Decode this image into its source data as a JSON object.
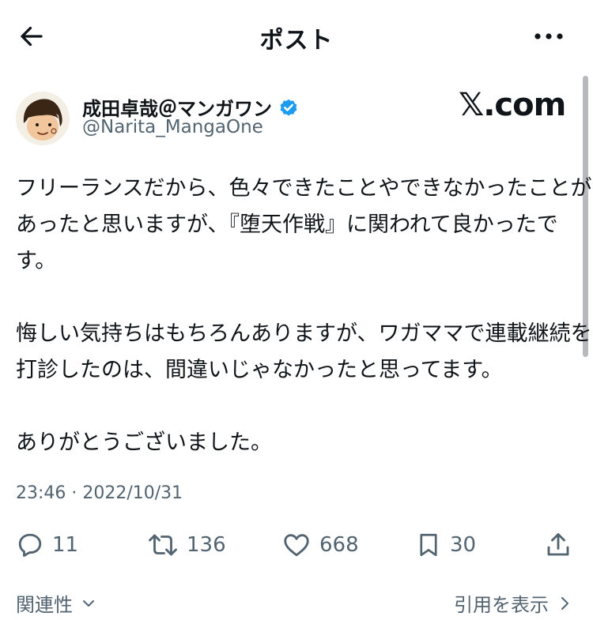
{
  "header": {
    "title": "ポスト",
    "back_icon": "arrow-left-icon",
    "more_icon": "more-horizontal-icon"
  },
  "author": {
    "name": "成田卓哉＠マンガワン",
    "handle": "@Narita_MangaOne",
    "verified": true,
    "verified_color": "#1d9bf0"
  },
  "watermark": "𝕏.com",
  "tweet": {
    "lines": [
      "フリーランスだから、色々できたことやできなかったことが",
      "あったと思いますが、『堕天作戦』に関われて良かったで",
      "す。",
      "",
      "悔しい気持ちはもちろんありますが、ワガママで連載継続を",
      "打診したのは、間違いじゃなかったと思ってます。",
      "",
      "ありがとうございました。"
    ],
    "timestamp": "23:46 · 2022/10/31"
  },
  "actions": {
    "reply": "11",
    "retweet": "136",
    "like": "668",
    "bookmark": "30"
  },
  "footer": {
    "related": "関連性",
    "quotes": "引用を表示"
  },
  "colors": {
    "text": "#0f1419",
    "muted": "#536471",
    "accent": "#1d9bf0"
  }
}
